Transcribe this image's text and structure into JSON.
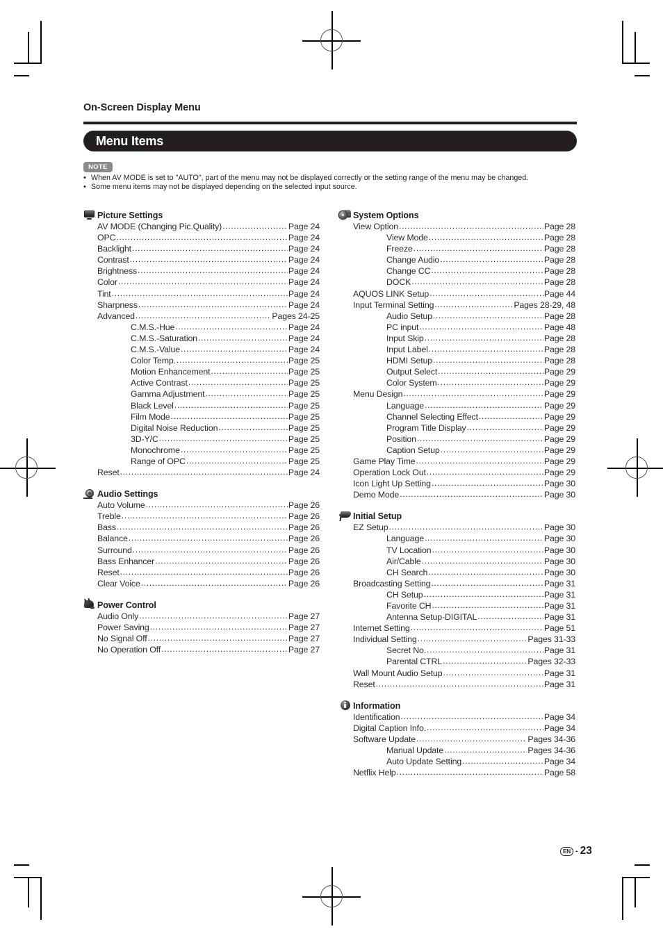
{
  "header": {
    "section_title": "On-Screen Display Menu",
    "banner_title": "Menu Items"
  },
  "note": {
    "badge": "NOTE",
    "items": [
      "When AV MODE is set to \"AUTO\", part of the menu may not be displayed correctly or the setting range of the menu may be changed.",
      "Some menu items may not be displayed depending on the selected input source."
    ]
  },
  "columns": {
    "left": [
      {
        "icon": "monitor-icon",
        "title": "Picture Settings",
        "entries": [
          {
            "level": 0,
            "label": "AV MODE (Changing Pic.Quality)",
            "page": "Page 24"
          },
          {
            "level": 0,
            "label": "OPC",
            "page": "Page 24"
          },
          {
            "level": 0,
            "label": "Backlight",
            "page": "Page 24"
          },
          {
            "level": 0,
            "label": "Contrast",
            "page": "Page 24"
          },
          {
            "level": 0,
            "label": "Brightness",
            "page": "Page 24"
          },
          {
            "level": 0,
            "label": "Color",
            "page": "Page 24"
          },
          {
            "level": 0,
            "label": "Tint",
            "page": "Page 24"
          },
          {
            "level": 0,
            "label": "Sharpness",
            "page": "Page 24"
          },
          {
            "level": 0,
            "label": "Advanced",
            "page": "Pages 24-25"
          },
          {
            "level": 1,
            "label": "C.M.S.-Hue",
            "page": "Page 24"
          },
          {
            "level": 1,
            "label": "C.M.S.-Saturation",
            "page": "Page 24"
          },
          {
            "level": 1,
            "label": "C.M.S.-Value",
            "page": "Page 24"
          },
          {
            "level": 1,
            "label": "Color Temp.",
            "page": "Page 25"
          },
          {
            "level": 1,
            "label": "Motion Enhancement",
            "page": "Page 25"
          },
          {
            "level": 1,
            "label": "Active Contrast",
            "page": "Page 25"
          },
          {
            "level": 1,
            "label": "Gamma Adjustment",
            "page": "Page 25"
          },
          {
            "level": 1,
            "label": "Black Level",
            "page": "Page 25"
          },
          {
            "level": 1,
            "label": "Film Mode",
            "page": "Page 25"
          },
          {
            "level": 1,
            "label": "Digital Noise Reduction",
            "page": "Page 25"
          },
          {
            "level": 1,
            "label": "3D-Y/C",
            "page": "Page 25"
          },
          {
            "level": 1,
            "label": "Monochrome",
            "page": "Page 25"
          },
          {
            "level": 1,
            "label": "Range of OPC",
            "page": "Page 25"
          },
          {
            "level": 0,
            "label": "Reset",
            "page": "Page 24"
          }
        ]
      },
      {
        "icon": "speaker-icon",
        "title": "Audio Settings",
        "entries": [
          {
            "level": 0,
            "label": "Auto Volume",
            "page": "Page 26"
          },
          {
            "level": 0,
            "label": "Treble",
            "page": "Page 26"
          },
          {
            "level": 0,
            "label": "Bass",
            "page": "Page 26"
          },
          {
            "level": 0,
            "label": "Balance",
            "page": "Page 26"
          },
          {
            "level": 0,
            "label": "Surround",
            "page": "Page 26"
          },
          {
            "level": 0,
            "label": "Bass Enhancer",
            "page": "Page 26"
          },
          {
            "level": 0,
            "label": "Reset",
            "page": "Page 26"
          },
          {
            "level": 0,
            "label": "Clear Voice",
            "page": "Page 26"
          }
        ]
      },
      {
        "icon": "power-plug-icon",
        "title": "Power Control",
        "entries": [
          {
            "level": 0,
            "label": "Audio Only",
            "page": "Page 27"
          },
          {
            "level": 0,
            "label": "Power Saving",
            "page": "Page 27"
          },
          {
            "level": 0,
            "label": "No Signal Off",
            "page": "Page 27"
          },
          {
            "level": 0,
            "label": "No Operation Off",
            "page": "Page 27"
          }
        ]
      }
    ],
    "right": [
      {
        "icon": "gear-icon",
        "title": "System Options",
        "entries": [
          {
            "level": 0,
            "label": "View Option",
            "page": "Page 28"
          },
          {
            "level": 1,
            "label": "View Mode",
            "page": "Page 28"
          },
          {
            "level": 1,
            "label": "Freeze",
            "page": "Page 28"
          },
          {
            "level": 1,
            "label": "Change Audio",
            "page": "Page 28"
          },
          {
            "level": 1,
            "label": "Change CC",
            "page": "Page 28"
          },
          {
            "level": 1,
            "label": "DOCK",
            "page": "Page 28"
          },
          {
            "level": 0,
            "label": "AQUOS LINK Setup",
            "page": "Page 44"
          },
          {
            "level": 0,
            "label": "Input Terminal Setting",
            "page": "Pages 28-29, 48"
          },
          {
            "level": 1,
            "label": "Audio Setup",
            "page": "Page 28"
          },
          {
            "level": 1,
            "label": "PC input",
            "page": "Page 48"
          },
          {
            "level": 1,
            "label": "Input Skip",
            "page": "Page 28"
          },
          {
            "level": 1,
            "label": "Input Label",
            "page": "Page 28"
          },
          {
            "level": 1,
            "label": "HDMI Setup",
            "page": "Page 28"
          },
          {
            "level": 1,
            "label": "Output Select",
            "page": "Page 29"
          },
          {
            "level": 1,
            "label": "Color System",
            "page": "Page 29"
          },
          {
            "level": 0,
            "label": "Menu Design",
            "page": "Page 29"
          },
          {
            "level": 1,
            "label": "Language",
            "page": "Page 29"
          },
          {
            "level": 1,
            "label": "Channel Selecting Effect",
            "page": "Page 29"
          },
          {
            "level": 1,
            "label": "Program Title Display",
            "page": "Page 29"
          },
          {
            "level": 1,
            "label": "Position",
            "page": "Page 29"
          },
          {
            "level": 1,
            "label": "Caption Setup",
            "page": "Page 29"
          },
          {
            "level": 0,
            "label": "Game Play Time",
            "page": "Page 29"
          },
          {
            "level": 0,
            "label": "Operation Lock Out",
            "page": "Page 29"
          },
          {
            "level": 0,
            "label": "Icon Light Up Setting",
            "page": "Page 30"
          },
          {
            "level": 0,
            "label": "Demo Mode",
            "page": "Page 30"
          }
        ]
      },
      {
        "icon": "flag-icon",
        "title": "Initial Setup",
        "entries": [
          {
            "level": 0,
            "label": "EZ Setup",
            "page": "Page 30"
          },
          {
            "level": 1,
            "label": "Language",
            "page": "Page 30"
          },
          {
            "level": 1,
            "label": "TV Location",
            "page": "Page 30"
          },
          {
            "level": 1,
            "label": "Air/Cable",
            "page": "Page 30"
          },
          {
            "level": 1,
            "label": "CH Search",
            "page": "Page 30"
          },
          {
            "level": 0,
            "label": "Broadcasting Setting",
            "page": "Page 31"
          },
          {
            "level": 1,
            "label": "CH Setup",
            "page": "Page 31"
          },
          {
            "level": 1,
            "label": "Favorite CH",
            "page": "Page 31"
          },
          {
            "level": 1,
            "label": "Antenna Setup-DIGITAL",
            "page": "Page 31"
          },
          {
            "level": 0,
            "label": "Internet Setting",
            "page": "Page 51"
          },
          {
            "level": 0,
            "label": "Individual Setting",
            "page": "Pages 31-33"
          },
          {
            "level": 1,
            "label": "Secret No.",
            "page": "Page 31"
          },
          {
            "level": 1,
            "label": "Parental CTRL",
            "page": "Pages 32-33"
          },
          {
            "level": 0,
            "label": "Wall Mount Audio Setup",
            "page": "Page 31"
          },
          {
            "level": 0,
            "label": "Reset",
            "page": "Page 31"
          }
        ]
      },
      {
        "icon": "info-icon",
        "title": "Information",
        "entries": [
          {
            "level": 0,
            "label": "Identification",
            "page": "Page 34"
          },
          {
            "level": 0,
            "label": "Digital Caption Info.",
            "page": "Page 34"
          },
          {
            "level": 0,
            "label": "Software Update",
            "page": "Pages 34-36"
          },
          {
            "level": 1,
            "label": "Manual Update",
            "page": "Pages 34-36"
          },
          {
            "level": 1,
            "label": "Auto Update Setting",
            "page": "Page 34"
          },
          {
            "level": 0,
            "label": "Netflix Help",
            "page": "Page 58"
          }
        ]
      }
    ]
  },
  "footer": {
    "language_code": "EN",
    "separator": "-",
    "page_number": "23"
  }
}
